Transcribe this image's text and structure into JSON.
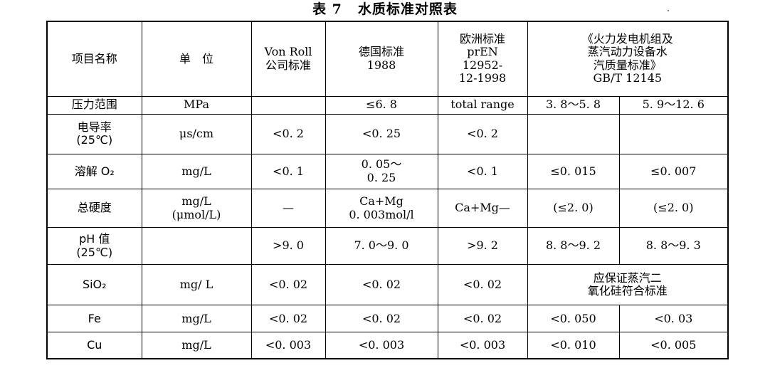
{
  "caption": {
    "number": "表 7",
    "text": "水质标准对照表"
  },
  "table": {
    "header": {
      "item": "项目名称",
      "unit": "单　位",
      "vonroll": [
        "Von Roll",
        "公司标准"
      ],
      "german": [
        "德国标准",
        "1988"
      ],
      "europe": [
        "欧洲标准",
        "prEN",
        "12952-",
        "12-1998"
      ],
      "gb": [
        "《火力发电机组及",
        "蒸汽动力设备水",
        "汽质量标准》",
        "GB/T 12145"
      ]
    },
    "rows": [
      {
        "name": [
          "压力范围"
        ],
        "unit": [
          "MPa"
        ],
        "vonroll": [
          ""
        ],
        "german": [
          "≤6. 8"
        ],
        "europe": [
          "total range"
        ],
        "gb1": [
          "3. 8～5. 8"
        ],
        "gb2": [
          "5. 9～12. 6"
        ]
      },
      {
        "name": [
          "电导率",
          "(25℃)"
        ],
        "unit": [
          "μs/cm"
        ],
        "vonroll": [
          "<0. 2"
        ],
        "german": [
          "<0. 25"
        ],
        "europe": [
          "<0. 2"
        ],
        "gb1": [
          ""
        ],
        "gb2": [
          ""
        ]
      },
      {
        "name": [
          "溶解 O₂"
        ],
        "unit": [
          "mg/L"
        ],
        "vonroll": [
          "<0. 1"
        ],
        "german": [
          "0. 05～",
          "0. 25"
        ],
        "europe": [
          "<0. 1"
        ],
        "gb1": [
          "≤0. 015"
        ],
        "gb2": [
          "≤0. 007"
        ]
      },
      {
        "name": [
          "总硬度"
        ],
        "unit": [
          "mg/L",
          "(μmol/L)"
        ],
        "vonroll": [
          "—"
        ],
        "german": [
          "Ca+Mg",
          "0. 003mol/l"
        ],
        "europe": [
          "Ca+Mg—"
        ],
        "gb1": [
          "(≤2. 0)"
        ],
        "gb2": [
          "(≤2. 0)"
        ]
      },
      {
        "name": [
          "pH 值",
          "(25℃)"
        ],
        "unit": [
          ""
        ],
        "vonroll": [
          ">9. 0"
        ],
        "german": [
          "7. 0～9. 0"
        ],
        "europe": [
          ">9. 2"
        ],
        "gb1": [
          "8. 8～9. 2"
        ],
        "gb2": [
          "8. 8～9. 3"
        ]
      },
      {
        "name": [
          "SiO₂"
        ],
        "unit": [
          "mg/ L"
        ],
        "vonroll": [
          "<0. 02"
        ],
        "german": [
          "<0. 02"
        ],
        "europe": [
          "<0. 02"
        ],
        "gb_merged": [
          "应保证蒸汽二",
          "氧化硅符合标准"
        ]
      },
      {
        "name": [
          "Fe"
        ],
        "unit": [
          "mg/L"
        ],
        "vonroll": [
          "<0. 02"
        ],
        "german": [
          "<0. 02"
        ],
        "europe": [
          "<0. 02"
        ],
        "gb1": [
          "<0. 050"
        ],
        "gb2": [
          "<0. 03"
        ]
      },
      {
        "name": [
          "Cu"
        ],
        "unit": [
          "mg/L"
        ],
        "vonroll": [
          "<0. 003"
        ],
        "german": [
          "<0. 003"
        ],
        "europe": [
          "<0. 003"
        ],
        "gb1": [
          "<0. 010"
        ],
        "gb2": [
          "<0. 005"
        ]
      }
    ]
  }
}
